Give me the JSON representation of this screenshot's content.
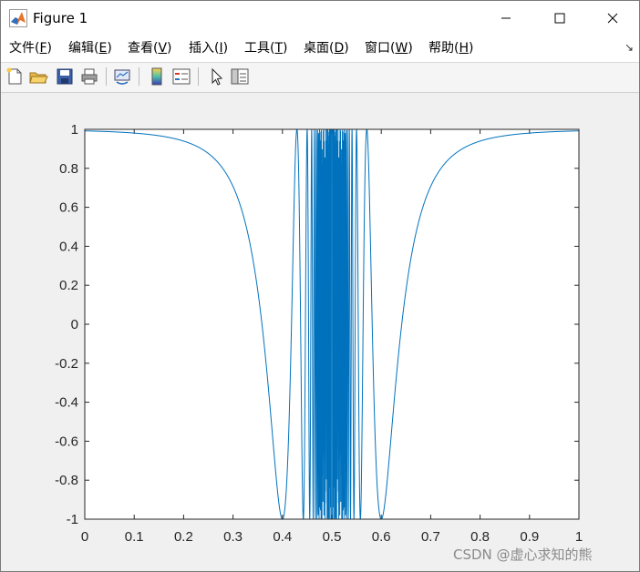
{
  "window": {
    "title": "Figure 1",
    "controls": {
      "minimize": "minimize",
      "maximize": "maximize",
      "close": "close"
    }
  },
  "menu": [
    {
      "label": "文件(",
      "key": "F",
      "suffix": ")"
    },
    {
      "label": "编辑(",
      "key": "E",
      "suffix": ")"
    },
    {
      "label": "查看(",
      "key": "V",
      "suffix": ")"
    },
    {
      "label": "插入(",
      "key": "I",
      "suffix": ")"
    },
    {
      "label": "工具(",
      "key": "T",
      "suffix": ")"
    },
    {
      "label": "桌面(",
      "key": "D",
      "suffix": ")"
    },
    {
      "label": "窗口(",
      "key": "W",
      "suffix": ")"
    },
    {
      "label": "帮助(",
      "key": "H",
      "suffix": ")"
    }
  ],
  "toolbar": {
    "icons": [
      "new-figure-icon",
      "open-file-icon",
      "save-icon",
      "print-icon",
      "link-plot-icon",
      "insert-colorbar-icon",
      "insert-legend-icon",
      "edit-plot-arrow-icon",
      "property-inspector-icon"
    ]
  },
  "chart_data": {
    "type": "line",
    "title": "",
    "xlabel": "",
    "ylabel": "",
    "xlim": [
      0,
      1
    ],
    "ylim": [
      -1,
      1
    ],
    "x_ticks": [
      "0",
      "0.1",
      "0.2",
      "0.3",
      "0.4",
      "0.5",
      "0.6",
      "0.7",
      "0.8",
      "0.9",
      "1"
    ],
    "y_ticks": [
      "1",
      "0.8",
      "0.6",
      "0.4",
      "0.2",
      "0",
      "-0.2",
      "-0.4",
      "-0.6",
      "-0.8",
      "-1"
    ],
    "grid": false,
    "series": [
      {
        "color": "#0072bd",
        "function": "y = cos(1/(x-0.5)^2 * 0.01 + ...)",
        "sample_x": [
          0,
          0.1,
          0.2,
          0.3,
          0.35,
          0.4,
          0.45,
          0.47,
          0.5,
          0.53,
          0.55,
          0.6,
          0.65,
          0.7,
          0.8,
          0.9,
          1
        ],
        "sample_y": [
          1,
          0.96,
          0.82,
          0.42,
          0.0,
          -1,
          1,
          -1,
          1,
          -1,
          1,
          -1,
          0.0,
          0.42,
          0.82,
          0.96,
          1
        ]
      }
    ]
  },
  "watermark": "CSDN @虚心求知的熊"
}
